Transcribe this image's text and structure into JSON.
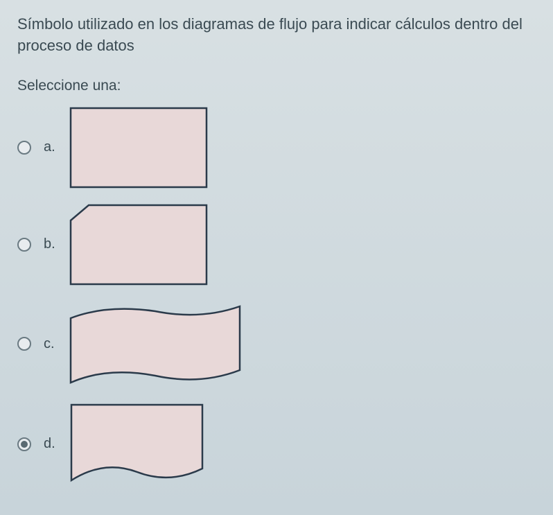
{
  "question": {
    "text": "Símbolo utilizado en los diagramas de flujo para indicar cálculos dentro del proceso de datos"
  },
  "instruction": "Seleccione una:",
  "options": [
    {
      "label": "a.",
      "selected": false,
      "shape": "rectangle"
    },
    {
      "label": "b.",
      "selected": false,
      "shape": "card"
    },
    {
      "label": "c.",
      "selected": false,
      "shape": "wavy"
    },
    {
      "label": "d.",
      "selected": true,
      "shape": "document"
    }
  ]
}
